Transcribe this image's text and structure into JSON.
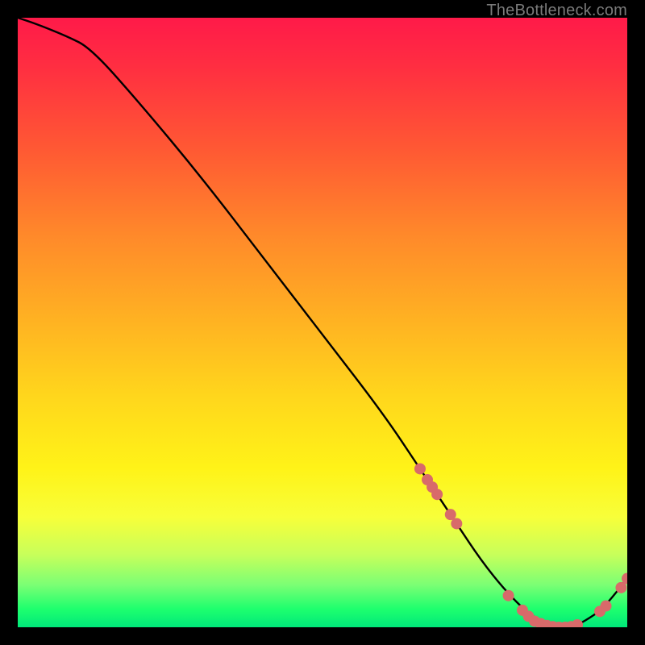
{
  "watermark": "TheBottleneck.com",
  "chart_data": {
    "type": "line",
    "title": "",
    "xlabel": "",
    "ylabel": "",
    "xlim": [
      0,
      100
    ],
    "ylim": [
      0,
      100
    ],
    "grid": false,
    "legend": false,
    "background": "rainbow-vertical-red-to-green",
    "series": [
      {
        "name": "bottleneck-curve",
        "color": "#000000",
        "x": [
          0,
          3,
          8,
          12,
          20,
          30,
          40,
          50,
          60,
          66,
          68,
          72,
          76,
          80,
          84,
          88,
          91,
          93,
          96,
          100
        ],
        "values": [
          100,
          99,
          97,
          95,
          86,
          74,
          61,
          48,
          35,
          26,
          23,
          17,
          11,
          6,
          2,
          0,
          0,
          1,
          3,
          8
        ]
      }
    ],
    "markers": {
      "name": "sample-points",
      "color": "#d86a6a",
      "radius_outer": 7,
      "radius_inner": 4.2,
      "points": [
        {
          "x": 66.0,
          "y": 26.0
        },
        {
          "x": 67.2,
          "y": 24.2
        },
        {
          "x": 68.0,
          "y": 23.0
        },
        {
          "x": 68.8,
          "y": 21.8
        },
        {
          "x": 71.0,
          "y": 18.5
        },
        {
          "x": 72.0,
          "y": 17.0
        },
        {
          "x": 80.5,
          "y": 5.2
        },
        {
          "x": 82.8,
          "y": 2.8
        },
        {
          "x": 83.8,
          "y": 1.8
        },
        {
          "x": 84.8,
          "y": 1.0
        },
        {
          "x": 85.8,
          "y": 0.6
        },
        {
          "x": 86.8,
          "y": 0.3
        },
        {
          "x": 87.8,
          "y": 0.1
        },
        {
          "x": 88.8,
          "y": 0.0
        },
        {
          "x": 89.8,
          "y": 0.0
        },
        {
          "x": 90.8,
          "y": 0.1
        },
        {
          "x": 91.8,
          "y": 0.4
        },
        {
          "x": 95.5,
          "y": 2.6
        },
        {
          "x": 96.5,
          "y": 3.5
        },
        {
          "x": 99.0,
          "y": 6.5
        },
        {
          "x": 100.0,
          "y": 8.0
        }
      ]
    }
  }
}
